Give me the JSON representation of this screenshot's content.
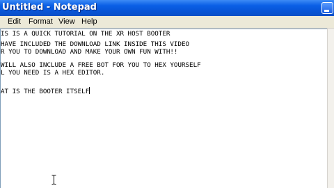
{
  "window": {
    "title": "Untitled - Notepad"
  },
  "menu": [
    {
      "label": "Edit"
    },
    {
      "label": "Format"
    },
    {
      "label": "View"
    },
    {
      "label": "Help"
    }
  ],
  "document": {
    "lines": [
      "IS IS A QUICK TUTORIAL ON THE XR HOST BOOTER",
      "",
      "HAVE INCLUDED THE DOWNLOAD LINK INSIDE THIS VIDEO",
      "R YOU TO DOWNLOAD AND MAKE YOUR OWN FUN WITH!!",
      "",
      "WILL ALSO INCLUDE A FREE BOT FOR YOU TO HEX YOURSELF",
      "L YOU NEED IS A HEX EDITOR.",
      "",
      "",
      "AT IS THE BOOTER ITSELF"
    ]
  },
  "icons": {
    "cursor": "text-ibeam-cursor-icon",
    "minimize": "minimize-icon"
  },
  "colors": {
    "titlebar": "#0a5fe6",
    "menubar": "#ece9d8",
    "editor_bg": "#ffffff"
  }
}
